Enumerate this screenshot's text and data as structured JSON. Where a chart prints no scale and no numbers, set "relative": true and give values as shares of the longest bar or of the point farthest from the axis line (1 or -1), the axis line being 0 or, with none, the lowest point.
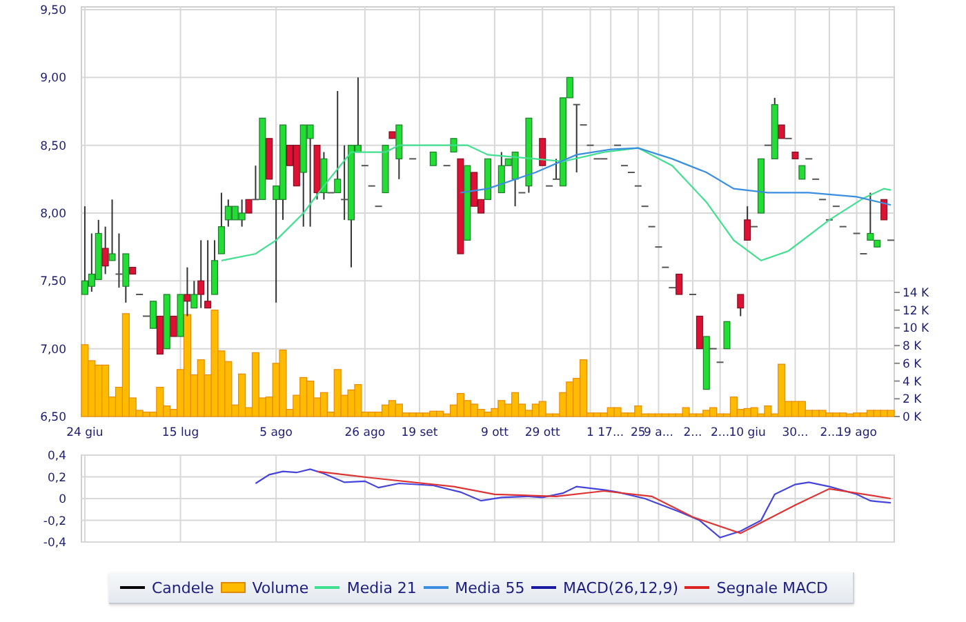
{
  "price_chart": {
    "chart_data": {
      "type": "candlestick",
      "ylim": [
        6.5,
        9.5
      ],
      "yticks": [
        {
          "value": 9.5,
          "label": "9,50"
        },
        {
          "value": 9,
          "label": "9,00"
        },
        {
          "value": 8.5,
          "label": "8,50"
        },
        {
          "value": 8,
          "label": "8,00"
        },
        {
          "value": 7.5,
          "label": "7,50"
        },
        {
          "value": 7,
          "label": "7,00"
        },
        {
          "value": 6.5,
          "label": "6,50"
        }
      ],
      "categories": [
        "24 giu",
        null,
        null,
        null,
        null,
        null,
        null,
        null,
        null,
        null,
        null,
        null,
        null,
        null,
        "15 lug",
        null,
        null,
        null,
        null,
        null,
        null,
        null,
        null,
        null,
        null,
        null,
        null,
        null,
        "5 ago",
        null,
        null,
        null,
        null,
        null,
        null,
        null,
        null,
        null,
        null,
        null,
        null,
        "26 ago",
        null,
        null,
        null,
        null,
        null,
        null,
        null,
        "19 set",
        null,
        null,
        null,
        null,
        null,
        null,
        null,
        null,
        null,
        null,
        "9 ott",
        null,
        null,
        null,
        null,
        null,
        null,
        "29 ott",
        null,
        null,
        null,
        null,
        null,
        null,
        "1",
        null,
        null,
        "17...",
        null,
        null,
        null,
        "25",
        null,
        null,
        "9 a...",
        null,
        null,
        null,
        null,
        "2...",
        null,
        null,
        null,
        "2...",
        null,
        null,
        null,
        "10 giu",
        null,
        null,
        null,
        null,
        null,
        null,
        "30...",
        null,
        null,
        null,
        null,
        "2...",
        null,
        null,
        null,
        "19 ago",
        null,
        null,
        null,
        null,
        null
      ],
      "ohlc": [
        [
          7.4,
          8.05,
          7.4,
          7.5
        ],
        [
          7.46,
          7.85,
          7.42,
          7.55
        ],
        [
          7.51,
          7.95,
          7.51,
          7.85
        ],
        [
          7.74,
          7.9,
          7.55,
          7.61
        ],
        [
          7.65,
          8.1,
          7.65,
          7.7
        ],
        [
          7.55,
          7.85,
          7.45,
          7.55
        ],
        [
          7.46,
          7.7,
          7.34,
          7.7
        ],
        [
          7.6,
          7.6,
          7.55,
          7.55
        ],
        [
          7.4,
          7.4,
          7.4,
          7.4
        ],
        [
          7.24,
          7.24,
          7.24,
          7.24
        ],
        [
          7.15,
          7.35,
          7.15,
          7.35
        ],
        [
          7.24,
          7.24,
          6.96,
          6.96
        ],
        [
          7.0,
          7.4,
          7.0,
          7.4
        ],
        [
          7.24,
          7.24,
          7.09,
          7.09
        ],
        [
          7.09,
          7.4,
          7.09,
          7.4
        ],
        [
          7.4,
          7.6,
          7.24,
          7.35
        ],
        [
          7.3,
          7.5,
          7.3,
          7.4
        ],
        [
          7.5,
          7.8,
          7.3,
          7.4
        ],
        [
          7.35,
          7.8,
          7.3,
          7.3
        ],
        [
          7.4,
          7.8,
          7.4,
          7.65
        ],
        [
          7.7,
          8.15,
          7.7,
          7.9
        ],
        [
          7.95,
          8.1,
          7.9,
          8.05
        ],
        [
          7.95,
          8.05,
          7.95,
          8.05
        ],
        [
          7.95,
          8.1,
          7.9,
          8.0
        ],
        [
          8.1,
          8.1,
          8.0,
          8.0
        ],
        [
          8.1,
          8.35,
          8.1,
          8.1
        ],
        [
          8.1,
          8.7,
          8.1,
          8.7
        ],
        [
          8.55,
          8.55,
          8.25,
          8.25
        ],
        [
          8.1,
          8.2,
          7.34,
          8.2
        ],
        [
          8.1,
          8.65,
          7.95,
          8.65
        ],
        [
          8.5,
          8.5,
          8.35,
          8.35
        ],
        [
          8.5,
          8.5,
          8.2,
          8.2
        ],
        [
          8.3,
          8.65,
          7.9,
          8.65
        ],
        [
          8.55,
          8.65,
          7.9,
          8.65
        ],
        [
          8.5,
          8.5,
          8.1,
          8.15
        ],
        [
          8.15,
          8.45,
          8.1,
          8.4
        ],
        [
          8.15,
          8.15,
          8.15,
          8.15
        ],
        [
          8.15,
          8.9,
          8.15,
          8.25
        ],
        [
          8.1,
          8.5,
          7.95,
          8.1
        ],
        [
          7.95,
          8.5,
          7.6,
          8.5
        ],
        [
          8.45,
          9.0,
          8.45,
          8.5
        ],
        [
          8.35,
          8.35,
          8.35,
          8.35
        ],
        [
          8.2,
          8.2,
          8.2,
          8.2
        ],
        [
          8.05,
          8.05,
          8.05,
          8.05
        ],
        [
          8.15,
          8.5,
          8.15,
          8.5
        ],
        [
          8.6,
          8.6,
          8.55,
          8.55
        ],
        [
          8.4,
          8.65,
          8.25,
          8.65
        ],
        null,
        [
          8.4,
          8.4,
          8.4,
          8.4
        ],
        null,
        null,
        [
          8.35,
          8.45,
          8.35,
          8.45
        ],
        null,
        [
          8.35,
          8.35,
          8.35,
          8.35
        ],
        [
          8.45,
          8.55,
          8.45,
          8.55
        ],
        [
          8.4,
          8.4,
          7.7,
          7.7
        ],
        [
          7.8,
          8.35,
          7.8,
          8.35
        ],
        [
          8.3,
          8.3,
          8.05,
          8.05
        ],
        [
          8.1,
          8.1,
          8.0,
          8.0
        ],
        [
          8.1,
          8.4,
          8.1,
          8.4
        ],
        null,
        [
          8.15,
          8.45,
          8.15,
          8.35
        ],
        [
          8.35,
          8.4,
          8.35,
          8.4
        ],
        [
          8.25,
          8.45,
          8.05,
          8.45
        ],
        [
          8.15,
          8.15,
          8.15,
          8.15
        ],
        [
          8.2,
          8.7,
          8.15,
          8.7
        ],
        null,
        [
          8.55,
          8.55,
          8.35,
          8.35
        ],
        [
          8.2,
          8.2,
          8.2,
          8.2
        ],
        [
          8.25,
          8.4,
          8.25,
          8.25
        ],
        [
          8.2,
          8.85,
          8.2,
          8.85
        ],
        [
          8.85,
          9.0,
          8.85,
          9.0
        ],
        [
          8.8,
          8.8,
          8.3,
          8.8
        ],
        [
          8.65,
          8.65,
          8.65,
          8.65
        ],
        [
          8.5,
          8.5,
          8.5,
          8.5
        ],
        [
          8.4,
          8.4,
          8.4,
          8.4
        ],
        [
          8.4,
          8.4,
          8.4,
          8.4
        ],
        null,
        [
          8.5,
          8.5,
          8.5,
          8.5
        ],
        [
          8.35,
          8.35,
          8.35,
          8.35
        ],
        [
          8.3,
          8.3,
          8.3,
          8.3
        ],
        [
          8.2,
          8.2,
          8.2,
          8.2
        ],
        [
          8.05,
          8.05,
          8.05,
          8.05
        ],
        [
          7.9,
          7.9,
          7.9,
          7.9
        ],
        [
          7.75,
          7.75,
          7.75,
          7.75
        ],
        [
          7.6,
          7.6,
          7.6,
          7.6
        ],
        [
          7.45,
          7.45,
          7.45,
          7.45
        ],
        [
          7.55,
          7.55,
          7.4,
          7.4
        ],
        null,
        [
          7.4,
          7.4,
          7.4,
          7.4
        ],
        [
          7.24,
          7.24,
          7.0,
          7.0
        ],
        [
          6.7,
          7.09,
          6.7,
          7.09
        ],
        [
          7.0,
          7.0,
          7.0,
          7.0
        ],
        [
          6.9,
          6.9,
          6.9,
          6.9
        ],
        [
          7.0,
          7.2,
          7.0,
          7.2
        ],
        null,
        [
          7.4,
          7.4,
          7.24,
          7.3
        ],
        [
          7.95,
          8.05,
          7.8,
          7.8
        ],
        [
          7.9,
          7.9,
          7.9,
          7.9
        ],
        [
          8.0,
          8.4,
          8.0,
          8.4
        ],
        [
          8.5,
          8.5,
          8.5,
          8.5
        ],
        [
          8.4,
          8.85,
          8.4,
          8.8
        ],
        [
          8.65,
          8.65,
          8.55,
          8.55
        ],
        [
          8.55,
          8.55,
          8.55,
          8.55
        ],
        [
          8.45,
          8.45,
          8.4,
          8.4
        ],
        [
          8.25,
          8.35,
          8.25,
          8.35
        ],
        [
          8.4,
          8.4,
          8.4,
          8.4
        ],
        [
          8.25,
          8.25,
          8.25,
          8.25
        ],
        [
          8.1,
          8.1,
          8.1,
          8.1
        ],
        [
          7.95,
          7.95,
          7.95,
          7.95
        ],
        [
          8.05,
          8.05,
          8.05,
          8.05
        ],
        [
          7.9,
          7.9,
          7.9,
          7.9
        ],
        null,
        [
          7.85,
          7.85,
          7.85,
          7.85
        ],
        [
          7.7,
          7.7,
          7.7,
          7.7
        ],
        [
          7.8,
          8.15,
          7.8,
          7.85
        ],
        [
          7.75,
          7.8,
          7.75,
          7.8
        ],
        [
          8.1,
          8.1,
          7.95,
          7.95
        ],
        [
          7.8,
          7.8,
          7.8,
          7.8
        ]
      ]
    }
  },
  "averages_chart": {
    "chart_data": {
      "type": "line",
      "relative": true,
      "ylim": [
        6.5,
        9.5
      ],
      "categories": [
        null,
        null,
        null,
        null,
        null,
        null,
        null,
        null,
        null,
        null,
        null,
        null,
        null,
        null,
        null,
        null,
        null,
        null,
        null,
        null,
        null,
        null,
        null,
        null,
        null,
        null,
        null,
        null,
        null,
        null,
        null,
        null,
        null,
        null,
        null,
        null,
        null,
        null,
        null,
        null,
        null,
        null,
        null,
        null,
        null,
        null,
        null,
        null,
        null,
        null,
        null,
        null,
        null,
        null,
        null,
        null,
        null,
        null,
        null,
        null,
        null,
        null,
        null,
        null,
        null,
        null,
        null,
        null,
        null,
        null,
        null,
        null,
        null,
        null,
        null,
        null,
        null,
        null,
        null,
        null,
        null,
        null,
        null,
        null,
        null,
        null,
        null,
        null,
        null,
        null,
        null,
        null,
        null,
        null,
        null,
        null,
        null,
        null,
        null,
        null,
        null,
        null,
        null,
        null,
        null,
        null,
        null,
        null,
        null,
        null,
        null,
        null,
        null,
        null,
        null,
        null,
        null,
        null,
        null
      ],
      "series": [
        {
          "color": "#40e090",
          "values": [
            null,
            null,
            null,
            null,
            null,
            null,
            null,
            null,
            null,
            null,
            null,
            null,
            null,
            null,
            null,
            null,
            null,
            null,
            null,
            null,
            7.65,
            null,
            null,
            null,
            null,
            7.7,
            null,
            null,
            7.8,
            null,
            null,
            null,
            8.0,
            null,
            null,
            8.2,
            null,
            null,
            null,
            8.45,
            null,
            null,
            null,
            null,
            8.45,
            null,
            8.5,
            null,
            null,
            null,
            null,
            null,
            null,
            8.5,
            null,
            null,
            8.5,
            null,
            null,
            8.43,
            null,
            null,
            null,
            null,
            null,
            null,
            8.4,
            null,
            null,
            null,
            8.38,
            null,
            null,
            null,
            null,
            null,
            8.45,
            null,
            null,
            null,
            null,
            8.48,
            null,
            null,
            null,
            null,
            8.35,
            null,
            null,
            null,
            null,
            8.08,
            null,
            null,
            null,
            7.8,
            null,
            null,
            null,
            7.65,
            null,
            null,
            null,
            7.72,
            null,
            null,
            null,
            null,
            null,
            7.95,
            null,
            null,
            null,
            null,
            8.11,
            null,
            null,
            8.18,
            8.17
          ]
        },
        {
          "color": "#3a8ee0",
          "values": [
            null,
            null,
            null,
            null,
            null,
            null,
            null,
            null,
            null,
            null,
            null,
            null,
            null,
            null,
            null,
            null,
            null,
            null,
            null,
            null,
            null,
            null,
            null,
            null,
            null,
            null,
            null,
            null,
            null,
            null,
            null,
            null,
            null,
            null,
            null,
            null,
            null,
            null,
            null,
            null,
            null,
            null,
            null,
            null,
            null,
            null,
            null,
            null,
            null,
            null,
            null,
            null,
            null,
            null,
            null,
            8.15,
            null,
            null,
            null,
            8.18,
            null,
            null,
            null,
            null,
            null,
            null,
            8.3,
            null,
            null,
            null,
            null,
            null,
            8.43,
            null,
            null,
            null,
            null,
            8.47,
            null,
            null,
            null,
            8.48,
            null,
            null,
            null,
            null,
            8.4,
            null,
            null,
            null,
            null,
            8.3,
            null,
            null,
            null,
            8.18,
            null,
            null,
            null,
            null,
            8.15,
            null,
            null,
            null,
            null,
            null,
            8.15,
            null,
            null,
            null,
            null,
            null,
            null,
            8.12,
            null,
            null,
            null,
            null,
            8.06
          ]
        }
      ]
    }
  },
  "volume_chart": {
    "chart_data": {
      "type": "bar",
      "grid": true,
      "ylim": [
        0,
        14
      ],
      "yticks": [
        {
          "value": 14,
          "label": "14 K"
        },
        {
          "value": 12,
          "label": "12 K"
        },
        {
          "value": 10,
          "label": "10 K"
        },
        {
          "value": 8,
          "label": "8 K"
        },
        {
          "value": 6,
          "label": "6 K"
        },
        {
          "value": 4,
          "label": "4 K"
        },
        {
          "value": 2,
          "label": "2 K"
        },
        {
          "value": 0,
          "label": "0 K"
        }
      ],
      "series": [
        {
          "color": "#ffbb00",
          "values": [
            8.1,
            6.3,
            5.8,
            5.8,
            2.2,
            3.3,
            11.6,
            2.1,
            0.7,
            0.5,
            0.5,
            3.3,
            1.2,
            0.8,
            5.3,
            11.5,
            4.7,
            6.4,
            4.7,
            12.0,
            7.4,
            6.2,
            1.3,
            4.8,
            1.0,
            7.2,
            2.1,
            2.2,
            6.0,
            7.5,
            0.8,
            2.4,
            4.4,
            4.0,
            2.1,
            2.7,
            0.5,
            5.3,
            2.4,
            3.0,
            3.6,
            0.5,
            0.5,
            0.5,
            1.3,
            1.8,
            1.4,
            0.4,
            0.4,
            0.4,
            0.4,
            0.6,
            0.6,
            0.3,
            1.3,
            2.6,
            1.8,
            1.4,
            0.8,
            0.5,
            0.9,
            1.8,
            1.4,
            2.7,
            1.4,
            0.7,
            1.4,
            1.7,
            0.3,
            0.3,
            2.7,
            3.9,
            4.3,
            6.4,
            0.4,
            0.4,
            0.4,
            1.0,
            1.0,
            0.4,
            0.4,
            1.2,
            0.3,
            0.3,
            0.3,
            0.3,
            0.3,
            0.3,
            1.0,
            0.3,
            0.3,
            0.7,
            1.0,
            0.3,
            0.3,
            2.2,
            0.8,
            0.9,
            1.0,
            0.3,
            1.2,
            0.3,
            5.9,
            1.7,
            1.7,
            1.7,
            0.7,
            0.7,
            0.7,
            0.4,
            0.4,
            0.4,
            0.3,
            0.4,
            0.4,
            0.7,
            0.7,
            0.7,
            0.7
          ]
        }
      ]
    }
  },
  "macd_chart": {
    "chart_data": {
      "type": "line",
      "grid": true,
      "ylim": [
        -0.4,
        0.4
      ],
      "categories": [
        null,
        null,
        null,
        null,
        null,
        null,
        null,
        null,
        null,
        null,
        null,
        null,
        null,
        null,
        null,
        null,
        null,
        null,
        null,
        null,
        null,
        null,
        null,
        null,
        null,
        null,
        null,
        null,
        null,
        null,
        null,
        null,
        null,
        null,
        null,
        null,
        null,
        null,
        null,
        null,
        null,
        null,
        null,
        null,
        null,
        null,
        null,
        null,
        null,
        null,
        null,
        null,
        null,
        null,
        null,
        null,
        null,
        null,
        null,
        null,
        null,
        null,
        null,
        null,
        null,
        null,
        null,
        null,
        null,
        null,
        null,
        null,
        null,
        null,
        null,
        null,
        null,
        null,
        null,
        null,
        null,
        null,
        null,
        null,
        null,
        null,
        null,
        null,
        null,
        null,
        null,
        null,
        null,
        null,
        null,
        null,
        null,
        null,
        null,
        null,
        null,
        null,
        null,
        null,
        null,
        null,
        null,
        null,
        null,
        null,
        null,
        null,
        null,
        null,
        null,
        null,
        null,
        null,
        null
      ],
      "yticks": [
        {
          "value": 0.4,
          "label": "0,4"
        },
        {
          "value": 0.2,
          "label": "0,2"
        },
        {
          "value": 0,
          "label": "0"
        },
        {
          "value": -0.2,
          "label": "-0,2"
        },
        {
          "value": -0.4,
          "label": "-0,4"
        }
      ],
      "series": [
        {
          "color": "#4444dd",
          "values": [
            null,
            null,
            null,
            null,
            null,
            null,
            null,
            null,
            null,
            null,
            null,
            null,
            null,
            null,
            null,
            null,
            null,
            null,
            null,
            null,
            null,
            null,
            null,
            null,
            null,
            0.14,
            null,
            0.22,
            null,
            0.25,
            null,
            0.24,
            null,
            0.27,
            null,
            0.23,
            null,
            null,
            0.15,
            null,
            null,
            0.16,
            null,
            0.1,
            null,
            null,
            0.14,
            null,
            null,
            null,
            null,
            0.12,
            null,
            null,
            null,
            0.06,
            null,
            null,
            -0.02,
            null,
            null,
            0.01,
            null,
            null,
            null,
            0.02,
            null,
            0.01,
            null,
            null,
            0.05,
            null,
            0.11,
            null,
            null,
            null,
            0.08,
            null,
            0.06,
            null,
            null,
            null,
            0,
            null,
            null,
            null,
            null,
            -0.12,
            null,
            null,
            -0.2,
            null,
            null,
            -0.36,
            null,
            null,
            -0.3,
            null,
            null,
            -0.2,
            null,
            0.04,
            null,
            null,
            0.13,
            null,
            0.15,
            null,
            null,
            0.11,
            null,
            null,
            null,
            0.04,
            null,
            -0.02,
            null,
            null,
            -0.04
          ]
        },
        {
          "color": "#dd3333",
          "values": [
            null,
            null,
            null,
            null,
            null,
            null,
            null,
            null,
            null,
            null,
            null,
            null,
            null,
            null,
            null,
            null,
            null,
            null,
            null,
            null,
            null,
            null,
            null,
            null,
            null,
            null,
            null,
            null,
            null,
            null,
            null,
            null,
            null,
            null,
            0.25,
            null,
            null,
            null,
            null,
            null,
            null,
            null,
            0.19,
            null,
            null,
            null,
            null,
            null,
            null,
            null,
            null,
            null,
            null,
            null,
            0.11,
            null,
            null,
            null,
            null,
            null,
            0.04,
            null,
            null,
            null,
            null,
            null,
            null,
            null,
            null,
            0.02,
            null,
            null,
            null,
            null,
            null,
            null,
            0.07,
            null,
            null,
            null,
            null,
            null,
            null,
            0.02,
            null,
            null,
            null,
            null,
            null,
            -0.17,
            null,
            null,
            null,
            null,
            null,
            null,
            -0.32,
            null,
            null,
            null,
            null,
            null,
            null,
            null,
            -0.06,
            null,
            null,
            null,
            null,
            0.09,
            null,
            null,
            null,
            null,
            null,
            null,
            null,
            null,
            0
          ]
        }
      ]
    }
  },
  "legend": {
    "items": [
      {
        "label": "Candele",
        "kind": "line",
        "color": "#000000"
      },
      {
        "label": "Volume",
        "kind": "bar",
        "color": "#ffbb00"
      },
      {
        "label": "Media 21",
        "kind": "line",
        "color": "#40e090"
      },
      {
        "label": "Media 55",
        "kind": "line",
        "color": "#3a8ee0"
      },
      {
        "label": "MACD(26,12,9)",
        "kind": "line",
        "color": "#1a1aa0"
      },
      {
        "label": "Segnale MACD",
        "kind": "line",
        "color": "#dd2222"
      }
    ]
  }
}
